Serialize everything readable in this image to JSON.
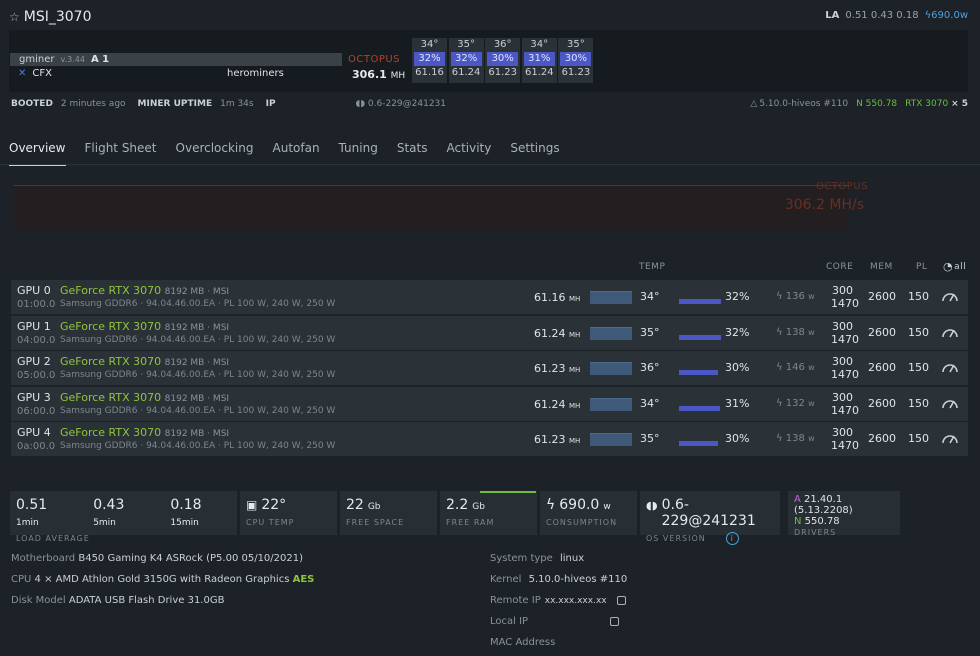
{
  "header": {
    "star_icon": "star-icon",
    "rig_name": "MSI_3070",
    "la_label": "LA",
    "la_values": "0.51 0.43 0.18",
    "power": "690.0",
    "power_unit": "w"
  },
  "miner": {
    "name": "gminer",
    "version": "v.3.44",
    "api": "A 1",
    "coin": "CFX",
    "pool": "herominers",
    "algo": "OCTOPUS",
    "hashrate": "306.1",
    "hash_unit": "MH"
  },
  "gpu_summary": [
    {
      "temp": "34°",
      "fan": "32%",
      "hash": "61.16"
    },
    {
      "temp": "35°",
      "fan": "32%",
      "hash": "61.24"
    },
    {
      "temp": "36°",
      "fan": "30%",
      "hash": "61.23"
    },
    {
      "temp": "34°",
      "fan": "31%",
      "hash": "61.24"
    },
    {
      "temp": "35°",
      "fan": "30%",
      "hash": "61.23"
    }
  ],
  "infoline": {
    "booted_label": "BOOTED",
    "booted_value": "2 minutes ago",
    "uptime_label": "MINER UPTIME",
    "uptime_value": "1m 34s",
    "ip_label": "IP",
    "os": "0.6-229@241231",
    "kernel": "5.10.0-hiveos #110",
    "nvidia": "N 550.78",
    "gpu_model": "RTX 3070",
    "gpu_count": "× 5"
  },
  "tabs": [
    "Overview",
    "Flight Sheet",
    "Overclocking",
    "Autofan",
    "Tuning",
    "Stats",
    "Activity",
    "Settings"
  ],
  "graph": {
    "algo": "OCTOPUS",
    "hashrate": "306.2 MH/s"
  },
  "table_headers": {
    "temp": "TEMP",
    "core": "CORE",
    "mem": "MEM",
    "pl": "PL",
    "all": "all"
  },
  "gpus": [
    {
      "id": "GPU 0",
      "bus": "01:00.0",
      "name": "GeForce RTX 3070",
      "extra": "8192 MB · MSI",
      "mem": "Samsung GDDR6 · 94.04.46.00.EA · PL 100 W, 240 W, 250 W",
      "hash": "61.16",
      "hash_unit": "MH",
      "temp": "34°",
      "fan": "32%",
      "power": "136",
      "power_unit": "w",
      "core": "300",
      "core2": "1470",
      "memclk": "2600",
      "pl": "150"
    },
    {
      "id": "GPU 1",
      "bus": "04:00.0",
      "name": "GeForce RTX 3070",
      "extra": "8192 MB · MSI",
      "mem": "Samsung GDDR6 · 94.04.46.00.EA · PL 100 W, 240 W, 250 W",
      "hash": "61.24",
      "hash_unit": "MH",
      "temp": "35°",
      "fan": "32%",
      "power": "138",
      "power_unit": "w",
      "core": "300",
      "core2": "1470",
      "memclk": "2600",
      "pl": "150"
    },
    {
      "id": "GPU 2",
      "bus": "05:00.0",
      "name": "GeForce RTX 3070",
      "extra": "8192 MB · MSI",
      "mem": "Samsung GDDR6 · 94.04.46.00.EA · PL 100 W, 240 W, 250 W",
      "hash": "61.23",
      "hash_unit": "MH",
      "temp": "36°",
      "fan": "30%",
      "power": "146",
      "power_unit": "w",
      "core": "300",
      "core2": "1470",
      "memclk": "2600",
      "pl": "150"
    },
    {
      "id": "GPU 3",
      "bus": "06:00.0",
      "name": "GeForce RTX 3070",
      "extra": "8192 MB · MSI",
      "mem": "Samsung GDDR6 · 94.04.46.00.EA · PL 100 W, 240 W, 250 W",
      "hash": "61.24",
      "hash_unit": "MH",
      "temp": "34°",
      "fan": "31%",
      "power": "132",
      "power_unit": "w",
      "core": "300",
      "core2": "1470",
      "memclk": "2600",
      "pl": "150"
    },
    {
      "id": "GPU 4",
      "bus": "0a:00.0",
      "name": "GeForce RTX 3070",
      "extra": "8192 MB · MSI",
      "mem": "Samsung GDDR6 · 94.04.46.00.EA · PL 100 W, 240 W, 250 W",
      "hash": "61.23",
      "hash_unit": "MH",
      "temp": "35°",
      "fan": "30%",
      "power": "138",
      "power_unit": "w",
      "core": "300",
      "core2": "1470",
      "memclk": "2600",
      "pl": "150"
    }
  ],
  "stats": {
    "la1": "0.51",
    "la1_unit": "1min",
    "la5": "0.43",
    "la5_unit": "5min",
    "la15": "0.18",
    "la15_unit": "15min",
    "load_label": "LOAD AVERAGE",
    "cpu_temp": "22°",
    "cpu_temp_label": "CPU TEMP",
    "free_space": "22",
    "free_space_unit": "Gb",
    "free_space_label": "FREE SPACE",
    "free_ram": "2.2",
    "free_ram_unit": "Gb",
    "free_ram_label": "FREE RAM",
    "consumption": "690.0",
    "consumption_unit": "w",
    "consumption_label": "CONSUMPTION",
    "os_version": "0.6-229@241231",
    "os_label": "OS VERSION",
    "driver_a": "21.40.1 (5.13.2208)",
    "driver_n": "550.78",
    "drivers_label": "DRIVERS"
  },
  "system": {
    "motherboard_label": "Motherboard",
    "motherboard": "B450 Gaming K4 ASRock (P5.00 05/10/2021)",
    "cpu_label": "CPU",
    "cpu": "4 × AMD Athlon Gold 3150G with Radeon Graphics",
    "cpu_aes": "AES",
    "disk_label": "Disk Model",
    "disk": "ADATA USB Flash Drive 31.0GB",
    "systype_label": "System type",
    "systype": "linux",
    "kernel_label": "Kernel",
    "kernel": "5.10.0-hiveos #110",
    "remoteip_label": "Remote IP",
    "remoteip": "xx.xxx.xxx.xx",
    "localip_label": "Local IP",
    "mac_label": "MAC Address"
  }
}
